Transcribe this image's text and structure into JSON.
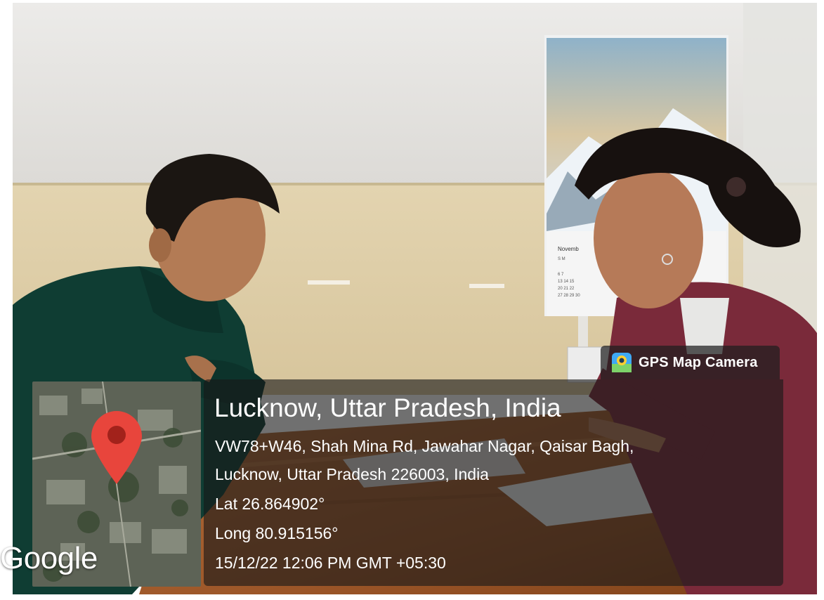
{
  "app": {
    "badge_label": "GPS Map Camera",
    "badge_icon": "camera-pin-icon"
  },
  "location": {
    "title": "Lucknow, Uttar Pradesh, India",
    "address_line1": "VW78+W46, Shah Mina Rd, Jawahar Nagar, Qaisar Bagh,",
    "address_line2": "Lucknow, Uttar Pradesh 226003, India",
    "lat": "Lat 26.864902°",
    "long": "Long 80.915156°",
    "datetime": "15/12/22 12:06 PM GMT +05:30"
  },
  "map": {
    "watermark": "Google",
    "pin_icon": "map-pin-icon",
    "pin_color": "#e8453c"
  },
  "calendar": {
    "month": "Novemb",
    "days_header": "S M"
  }
}
